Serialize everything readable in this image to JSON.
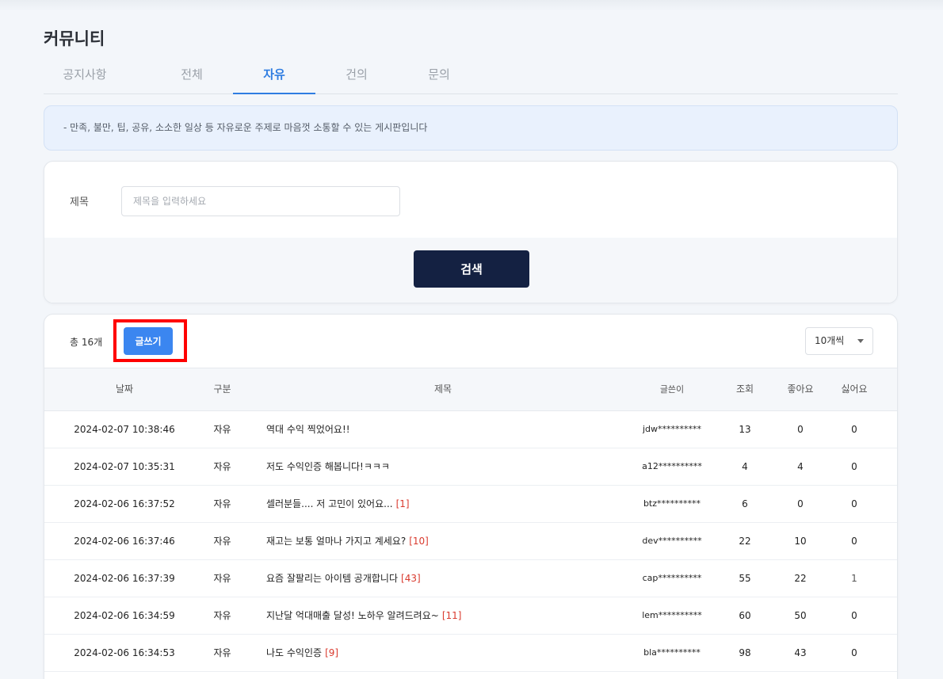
{
  "page_title": "커뮤니티",
  "tabs": [
    {
      "label": "공지사항"
    },
    {
      "label": "전체"
    },
    {
      "label": "자유"
    },
    {
      "label": "건의"
    },
    {
      "label": "문의"
    }
  ],
  "active_tab": "자유",
  "notice": {
    "text": "-  만족, 불만, 팁, 공유, 소소한 일상 등 자유로운 주제로 마음껏 소통할 수 있는 게시판입니다"
  },
  "search": {
    "label": "제목",
    "placeholder": "제목을 입력하세요",
    "value": "",
    "button_label": "검색"
  },
  "list": {
    "total_label": "총 16개",
    "write_button_label": "글쓰기",
    "per_page_label": "10개씩",
    "columns": {
      "date": "날짜",
      "type": "구분",
      "title": "제목",
      "author": "글쓴이",
      "views": "조회",
      "likes": "좋아요",
      "dislikes": "싫어요"
    },
    "rows": [
      {
        "date": "2024-02-07 10:38:46",
        "type": "자유",
        "title": "역대 수익 찍었어요!!",
        "comments": "",
        "author": "jdw**********",
        "views": "13",
        "likes": "0",
        "dislikes": "0"
      },
      {
        "date": "2024-02-07 10:35:31",
        "type": "자유",
        "title": "저도 수익인증 해봅니다!ㅋㅋㅋ",
        "comments": "",
        "author": "a12**********",
        "views": "4",
        "likes": "4",
        "dislikes": "0"
      },
      {
        "date": "2024-02-06 16:37:52",
        "type": "자유",
        "title": "셀러분들.... 저 고민이 있어요...",
        "comments": "[1]",
        "author": "btz**********",
        "views": "6",
        "likes": "0",
        "dislikes": "0"
      },
      {
        "date": "2024-02-06 16:37:46",
        "type": "자유",
        "title": "재고는 보통 얼마나 가지고 계세요?",
        "comments": "[10]",
        "author": "dev**********",
        "views": "22",
        "likes": "10",
        "dislikes": "0"
      },
      {
        "date": "2024-02-06 16:37:39",
        "type": "자유",
        "title": "요즘 잘팔리는 아이템 공개합니다",
        "comments": "[43]",
        "author": "cap**********",
        "views": "55",
        "likes": "22",
        "dislikes": "1"
      },
      {
        "date": "2024-02-06 16:34:59",
        "type": "자유",
        "title": "지난달 억대매출 달성! 노하우 알려드려요~",
        "comments": "[11]",
        "author": "lem**********",
        "views": "60",
        "likes": "50",
        "dislikes": "0"
      },
      {
        "date": "2024-02-06 16:34:53",
        "type": "자유",
        "title": "나도 수익인증",
        "comments": "[9]",
        "author": "bla**********",
        "views": "98",
        "likes": "43",
        "dislikes": "0"
      }
    ]
  },
  "colors": {
    "accent": "#2f7de1",
    "write_button": "#3b86f0",
    "search_button": "#142142",
    "comment_count": "#d93a2e",
    "highlight_box": "#ff0000"
  }
}
